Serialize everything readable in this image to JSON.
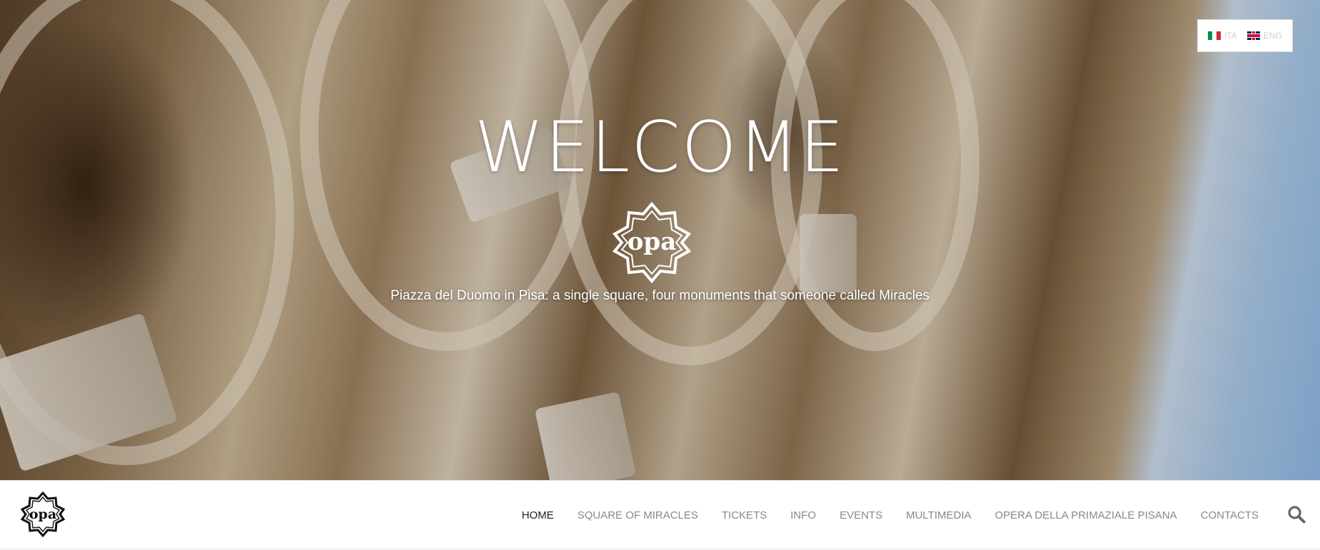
{
  "language_switcher": {
    "items": [
      {
        "code": "ITA",
        "flag": "italy-flag-icon"
      },
      {
        "code": "ENG",
        "flag": "uk-flag-icon"
      }
    ]
  },
  "hero": {
    "title": "WELCOME",
    "logo_text": "opa",
    "tagline": "Piazza del Duomo in Pisa: a single square, four monuments that someone called Miracles"
  },
  "navbar": {
    "logo_text": "opa",
    "menu": [
      {
        "label": "HOME",
        "active": true
      },
      {
        "label": "SQUARE OF MIRACLES",
        "active": false
      },
      {
        "label": "TICKETS",
        "active": false
      },
      {
        "label": "INFO",
        "active": false
      },
      {
        "label": "EVENTS",
        "active": false
      },
      {
        "label": "MULTIMEDIA",
        "active": false
      },
      {
        "label": "OPERA DELLA PRIMAZIALE PISANA",
        "active": false
      },
      {
        "label": "CONTACTS",
        "active": false
      }
    ],
    "search_icon": "search-icon"
  },
  "colors": {
    "nav_active": "#222222",
    "nav_inactive": "#888888",
    "sky": "#8fb7e3"
  }
}
